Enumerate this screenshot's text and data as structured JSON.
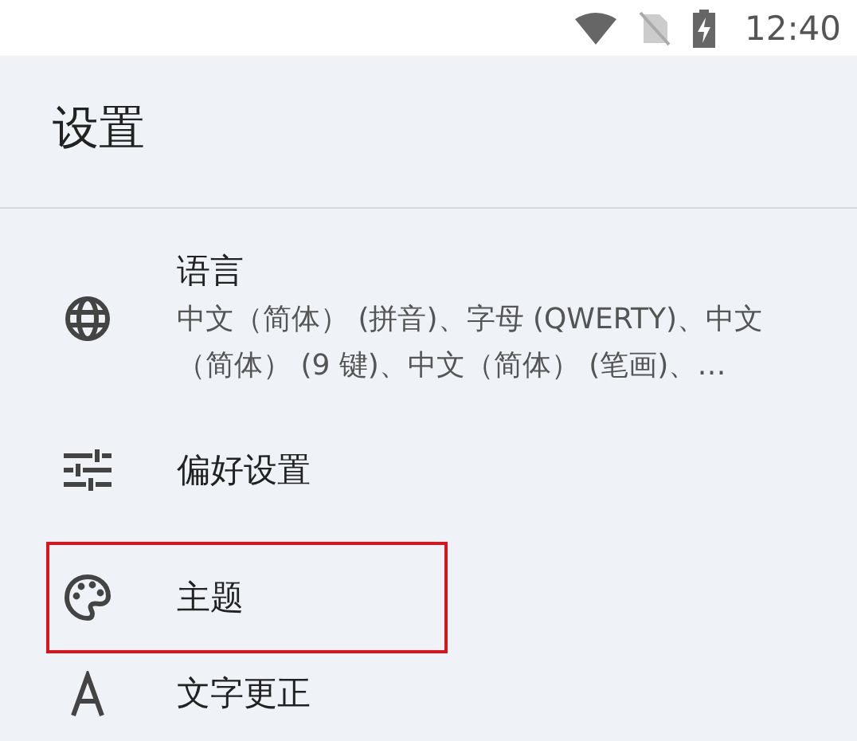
{
  "status_bar": {
    "time": "12:40"
  },
  "app_bar": {
    "title": "设置"
  },
  "items": [
    {
      "kind": "globe",
      "title": "语言",
      "subtitle": "中文（简体） (拼音)、字母 (QWERTY)、中文（简体） (9 键)、中文（简体） (笔画)、…",
      "highlighted": false
    },
    {
      "kind": "sliders",
      "title": "偏好设置",
      "highlighted": false
    },
    {
      "kind": "palette",
      "title": "主题",
      "highlighted": true
    },
    {
      "kind": "text",
      "title": "文字更正",
      "highlighted": false
    }
  ]
}
